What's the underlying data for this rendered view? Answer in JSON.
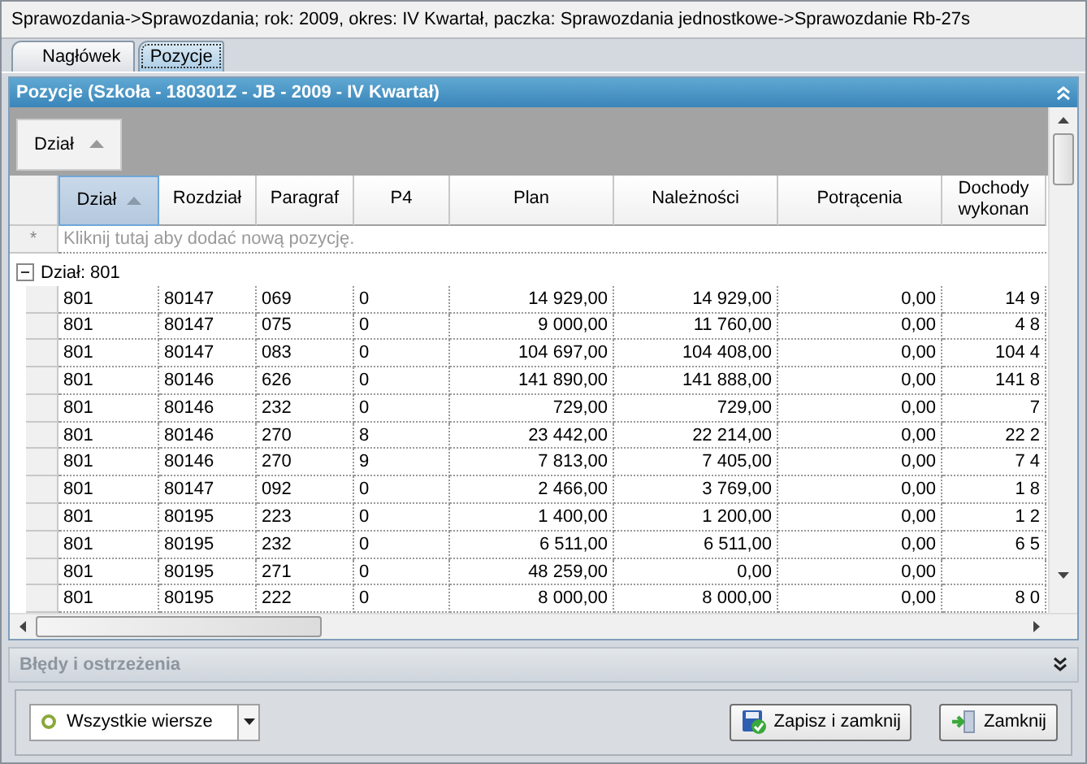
{
  "window": {
    "title": "Sprawozdania->Sprawozdania; rok: 2009, okres: IV Kwartał, paczka: Sprawozdania jednostkowe->Sprawozdanie Rb-27s"
  },
  "tabs": [
    {
      "label": "Nagłówek",
      "selected": false
    },
    {
      "label": "Pozycje",
      "selected": true
    }
  ],
  "panel": {
    "title": "Pozycje  (Szkoła - 180301Z - JB - 2009 - IV Kwartał)",
    "expanded": true
  },
  "group_by": [
    {
      "label": "Dział",
      "sorted": true
    }
  ],
  "table": {
    "columns": [
      {
        "label": "Dział",
        "sorted": true,
        "selected": true
      },
      {
        "label": "Rozdział",
        "selected": false
      },
      {
        "label": "Paragraf",
        "selected": false
      },
      {
        "label": "P4",
        "selected": false
      },
      {
        "label": "Plan",
        "selected": false
      },
      {
        "label": "Należności",
        "selected": false
      },
      {
        "label": "Potrącenia",
        "selected": false
      },
      {
        "label": "Dochody wykonan",
        "selected": false
      }
    ],
    "new_row": {
      "marker": "*",
      "placeholder": "Kliknij tutaj aby dodać nową pozycję."
    },
    "groups": [
      {
        "label": "Dział: 801",
        "expanded": true,
        "rows": [
          [
            "801",
            "80147",
            "069",
            "0",
            "14 929,00",
            "14 929,00",
            "0,00",
            "14 9"
          ],
          [
            "801",
            "80147",
            "075",
            "0",
            "9 000,00",
            "11 760,00",
            "0,00",
            "4 8"
          ],
          [
            "801",
            "80147",
            "083",
            "0",
            "104 697,00",
            "104 408,00",
            "0,00",
            "104 4"
          ],
          [
            "801",
            "80146",
            "626",
            "0",
            "141 890,00",
            "141 888,00",
            "0,00",
            "141 8"
          ],
          [
            "801",
            "80146",
            "232",
            "0",
            "729,00",
            "729,00",
            "0,00",
            "7"
          ],
          [
            "801",
            "80146",
            "270",
            "8",
            "23 442,00",
            "22 214,00",
            "0,00",
            "22 2"
          ],
          [
            "801",
            "80146",
            "270",
            "9",
            "7 813,00",
            "7 405,00",
            "0,00",
            "7 4"
          ],
          [
            "801",
            "80147",
            "092",
            "0",
            "2 466,00",
            "3 769,00",
            "0,00",
            "1 8"
          ],
          [
            "801",
            "80195",
            "223",
            "0",
            "1 400,00",
            "1 200,00",
            "0,00",
            "1 2"
          ],
          [
            "801",
            "80195",
            "232",
            "0",
            "6 511,00",
            "6 511,00",
            "0,00",
            "6 5"
          ],
          [
            "801",
            "80195",
            "271",
            "0",
            "48 259,00",
            "0,00",
            "0,00",
            ""
          ],
          [
            "801",
            "80195",
            "222",
            "0",
            "8 000,00",
            "8 000,00",
            "0,00",
            "8 0"
          ]
        ]
      }
    ]
  },
  "errors_panel": {
    "title": "Błędy i ostrzeżenia",
    "expanded": false
  },
  "filter": {
    "value": "Wszystkie wiersze"
  },
  "buttons": [
    {
      "label": "Zapisz i zamknij",
      "kind": "save"
    },
    {
      "label": "Zamknij",
      "kind": "close"
    }
  ]
}
